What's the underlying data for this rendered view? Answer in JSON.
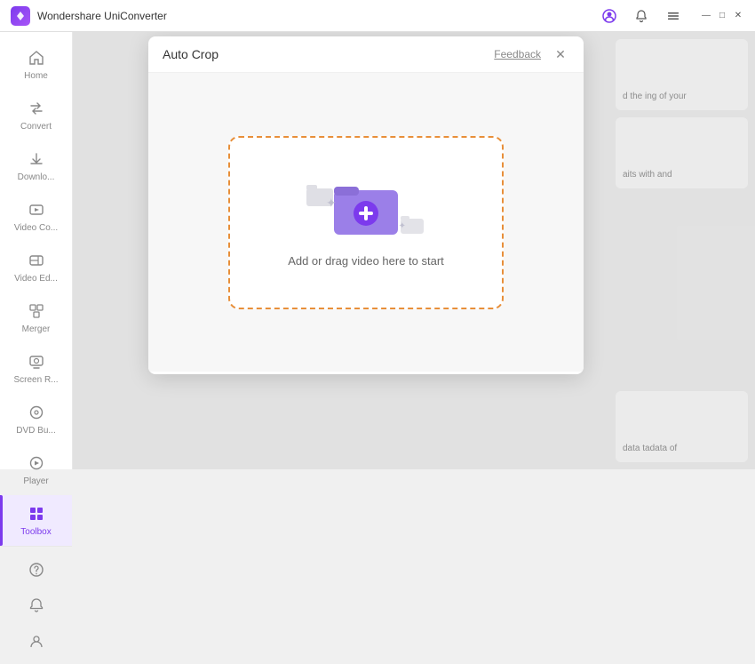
{
  "app": {
    "title": "Wondershare UniConverter",
    "logo_alt": "uniconverter-logo"
  },
  "title_bar": {
    "profile_icon": "person",
    "bell_icon": "bell",
    "menu_icon": "menu",
    "minimize_icon": "—",
    "maximize_icon": "□",
    "close_icon": "✕"
  },
  "sidebar": {
    "items": [
      {
        "id": "home",
        "label": "Home",
        "icon": "🏠",
        "active": false
      },
      {
        "id": "convert",
        "label": "Convert",
        "icon": "⇄",
        "active": false
      },
      {
        "id": "download",
        "label": "Downlo...",
        "icon": "⬇",
        "active": false
      },
      {
        "id": "video-compress",
        "label": "Video Co...",
        "icon": "📹",
        "active": false
      },
      {
        "id": "video-edit",
        "label": "Video Ed...",
        "icon": "✂",
        "active": false
      },
      {
        "id": "merger",
        "label": "Merger",
        "icon": "⊞",
        "active": false
      },
      {
        "id": "screen-record",
        "label": "Screen R...",
        "icon": "⊡",
        "active": false
      },
      {
        "id": "dvd-burn",
        "label": "DVD Bu...",
        "icon": "💿",
        "active": false
      },
      {
        "id": "player",
        "label": "Player",
        "icon": "▶",
        "active": false
      },
      {
        "id": "toolbox",
        "label": "Toolbox",
        "icon": "⊞",
        "active": true
      }
    ],
    "bottom_items": [
      {
        "id": "help",
        "icon": "?"
      },
      {
        "id": "notifications",
        "icon": "🔔"
      },
      {
        "id": "profile",
        "icon": "☺"
      }
    ]
  },
  "dialog": {
    "title": "Auto Crop",
    "feedback_label": "Feedback",
    "close_icon": "✕",
    "drop_zone": {
      "text": "Add or drag video here to start"
    }
  },
  "right_panel": {
    "cards": [
      {
        "text": "d the\ning of your"
      },
      {
        "text": "aits with\nand"
      },
      {
        "text": "data\ntadata of"
      }
    ]
  }
}
